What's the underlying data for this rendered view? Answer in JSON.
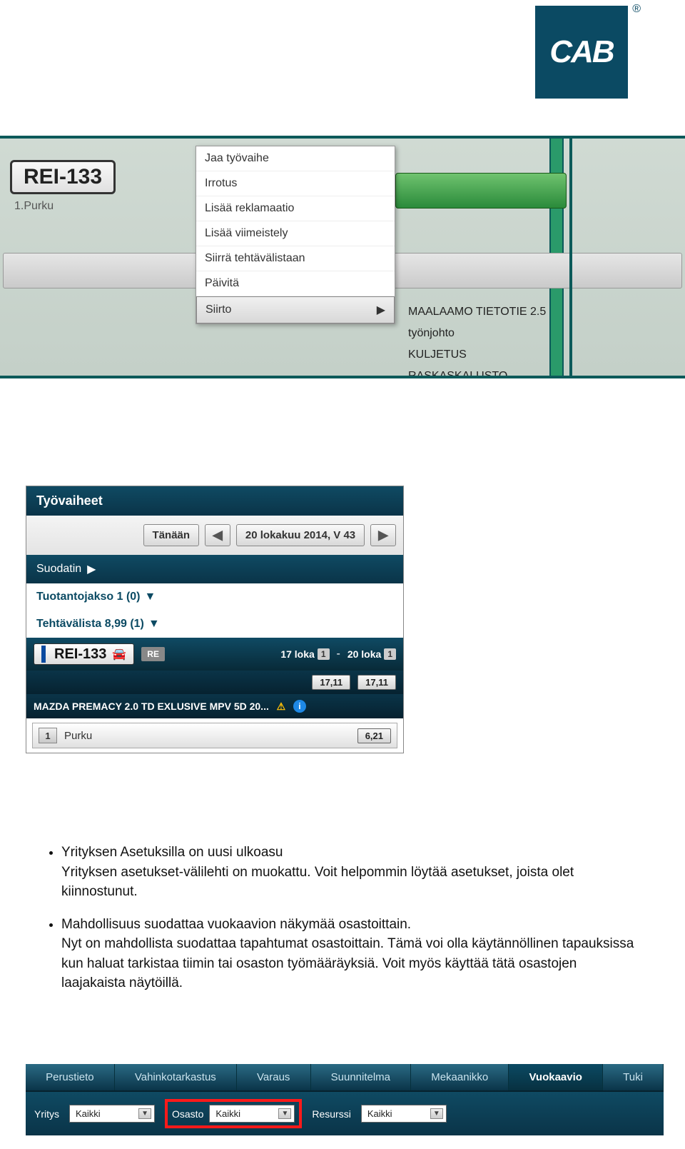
{
  "logo": {
    "text": "CAB",
    "registered": "®"
  },
  "section1": {
    "plate": "REI-133",
    "purku_label": "1.Purku",
    "context_menu": {
      "items": [
        "Jaa työvaihe",
        "Irrotus",
        "Lisää reklamaatio",
        "Lisää viimeistely",
        "Siirrä tehtävälistaan",
        "Päivitä"
      ],
      "selected": "Siirto"
    },
    "submenu": [
      "MAALAAMO TIETOTIE 2.5",
      "työnjohto",
      "KULJETUS",
      "RASKASKALUSTO"
    ]
  },
  "section2": {
    "title": "Työvaiheet",
    "today_btn": "Tänään",
    "date_btn": "20 lokakuu 2014, V 43",
    "filter_label": "Suodatin",
    "group1": "Tuotantojakso 1 (0)",
    "group2": "Tehtävälista 8,99 (1)",
    "plate": "REI-133",
    "re_badge": "RE",
    "date_from": "17 loka",
    "date_from_n": "1",
    "date_to": "20 loka",
    "date_to_n": "1",
    "val1": "17,11",
    "val2": "17,11",
    "desc": "MAZDA PREMACY 2.0 TD EXLUSIVE MPV 5D 20...",
    "task_num": "1",
    "task_name": "Purku",
    "task_val": "6,21"
  },
  "doc": {
    "bullet1": "Yrityksen Asetuksilla on uusi ulkoasu",
    "bullet1b": "Yrityksen asetukset-välilehti on muokattu. Voit helpommin löytää asetukset, joista olet kiinnostunut.",
    "bullet2": "Mahdollisuus suodattaa vuokaavion näkymää osastoittain.",
    "bullet2b": "Nyt on mahdollista suodattaa tapahtumat osastoittain. Tämä voi olla käytännöllinen tapauksissa kun haluat tarkistaa tiimin tai osaston työmääräyksiä. Voit myös käyttää tätä osastojen laajakaista näytöillä."
  },
  "section3": {
    "tabs": [
      "Perustieto",
      "Vahinkotarkastus",
      "Varaus",
      "Suunnitelma",
      "Mekaanikko",
      "Vuokaavio",
      "Tuki"
    ],
    "active_tab": "Vuokaavio",
    "yritys_label": "Yritys",
    "yritys_val": "Kaikki",
    "osasto_label": "Osasto",
    "osasto_val": "Kaikki",
    "resurssi_label": "Resurssi",
    "resurssi_val": "Kaikki"
  }
}
